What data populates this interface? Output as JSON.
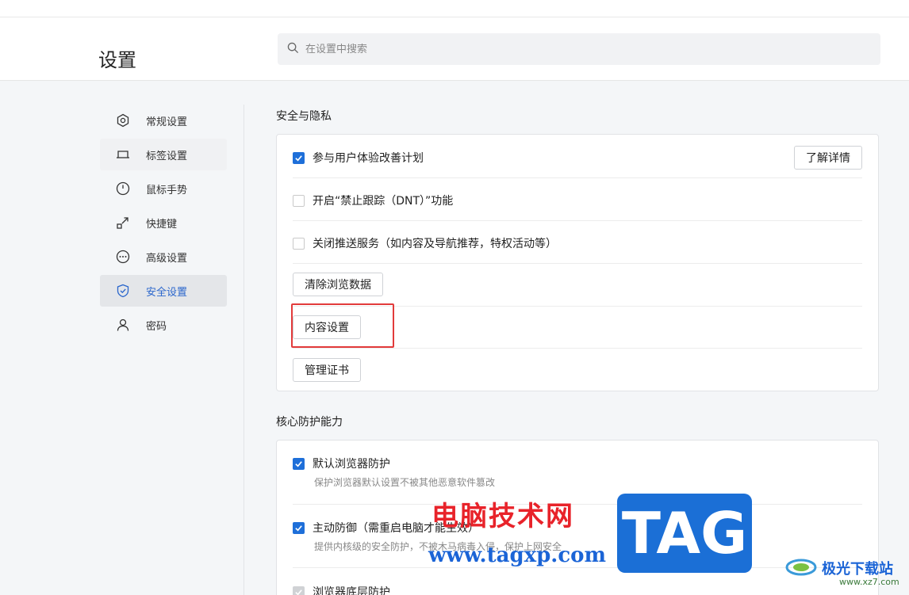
{
  "header": {
    "title": "设置",
    "search_placeholder": "在设置中搜索"
  },
  "sidebar": {
    "items": [
      {
        "label": "常规设置",
        "icon": "hexagon-icon",
        "state": "normal"
      },
      {
        "label": "标签设置",
        "icon": "tab-icon",
        "state": "hover"
      },
      {
        "label": "鼠标手势",
        "icon": "mouse-icon",
        "state": "normal"
      },
      {
        "label": "快捷键",
        "icon": "shortcut-arrow-icon",
        "state": "normal"
      },
      {
        "label": "高级设置",
        "icon": "more-dots-icon",
        "state": "normal"
      },
      {
        "label": "安全设置",
        "icon": "shield-icon",
        "state": "active"
      },
      {
        "label": "密码",
        "icon": "user-icon",
        "state": "normal"
      }
    ]
  },
  "security": {
    "title": "安全与隐私",
    "ux_plan": {
      "label": "参与用户体验改善计划",
      "checked": true,
      "button": "了解详情"
    },
    "dnt": {
      "label": "开启“禁止跟踪（DNT）”功能",
      "checked": false
    },
    "push": {
      "label": "关闭推送服务（如内容及导航推荐，特权活动等）",
      "checked": false
    },
    "buttons": {
      "clear_data": "清除浏览数据",
      "content_settings": "内容设置",
      "manage_certs": "管理证书"
    }
  },
  "core": {
    "title": "核心防护能力",
    "items": [
      {
        "label": "默认浏览器防护",
        "desc": "保护浏览器默认设置不被其他恶意软件篡改",
        "checked": true
      },
      {
        "label": "主动防御（需重启电脑才能生效）",
        "desc": "提供内核级的安全防护，不被木马病毒入侵，保护上网安全",
        "checked": true
      },
      {
        "label": "浏览器底层防护",
        "checked": true,
        "disabled": true
      }
    ]
  },
  "watermark": {
    "cn_text": "电脑技术网",
    "url": "www.tagxp.com",
    "tag": "TAG",
    "site_name": "极光下载站",
    "site_domain": "www.xz7.com"
  },
  "colors": {
    "accent": "#1e6fd9",
    "highlight_box": "#e23b3b"
  }
}
